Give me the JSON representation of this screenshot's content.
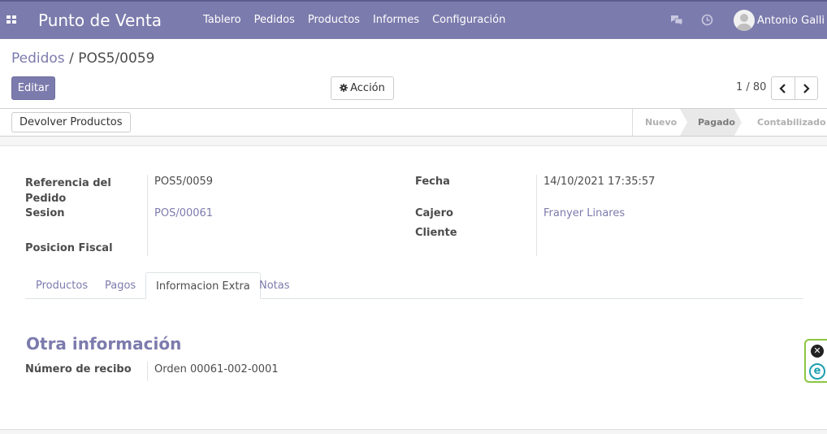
{
  "navbar": {
    "app_title": "Punto de Venta",
    "menu": [
      "Tablero",
      "Pedidos",
      "Productos",
      "Informes",
      "Configuración"
    ],
    "user_name": "Antonio Galli"
  },
  "control_panel": {
    "breadcrumb_parent": "Pedidos",
    "breadcrumb_separator": "/",
    "breadcrumb_current": "POS5/0059",
    "edit_label": "Editar",
    "action_label": "Acción",
    "pager": "1 / 80"
  },
  "status": {
    "return_button": "Devolver Productos",
    "stages": {
      "new": "Nuevo",
      "paid": "Pagado",
      "posted": "Contabilizado"
    },
    "current_stage": "Pagado"
  },
  "form": {
    "order_ref_label": "Referencia del Pedido",
    "order_ref_value": "POS5/0059",
    "session_label": "Sesion",
    "session_value": "POS/00061",
    "fiscal_position_label": "Posicion Fiscal",
    "fiscal_position_value": "",
    "date_label": "Fecha",
    "date_value": "14/10/2021 17:35:57",
    "cashier_label": "Cajero",
    "cashier_value": "Franyer Linares",
    "customer_label": "Cliente",
    "customer_value": ""
  },
  "tabs": {
    "products": "Productos",
    "payments": "Pagos",
    "extra_info": "Informacion Extra",
    "notes": "Notas",
    "active": "Informacion Extra"
  },
  "extra": {
    "section_title": "Otra información",
    "receipt_label": "Número de recibo",
    "receipt_value": "Orden 00061-002-0001"
  },
  "widget": {
    "close_glyph": "✕",
    "logo_letter": "e"
  },
  "colors": {
    "brand": "#7c7bad",
    "widget_border": "#8cc63f",
    "widget_logo": "#1e9fb1"
  }
}
